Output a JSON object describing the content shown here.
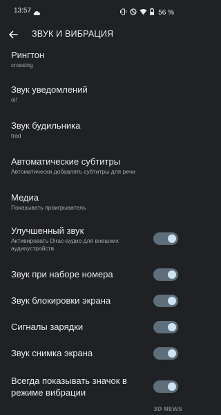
{
  "status_bar": {
    "time": "13:57",
    "battery_percent": "56 %"
  },
  "app_bar": {
    "title": "ЗВУК И ВИБРАЦИЯ"
  },
  "items": [
    {
      "title": "Рингтон",
      "subtitle": "crossing"
    },
    {
      "title": "Звук уведомлений",
      "subtitle": "oi!"
    },
    {
      "title": "Звук будильника",
      "subtitle": "trad"
    },
    {
      "title": "Автоматические субтитры",
      "subtitle": "Автоматически добавлять субтитры для речи"
    },
    {
      "title": "Медиа",
      "subtitle": "Показывать проигрыватель"
    },
    {
      "title": "Улучшенный звук",
      "subtitle": "Активировать Dirac-аудио для внешних аудиоустройств",
      "toggle": true
    },
    {
      "title": "Звук при наборе номера",
      "toggle": true
    },
    {
      "title": "Звук блокировки экрана",
      "toggle": true
    },
    {
      "title": "Сигналы зарядки",
      "toggle": true
    },
    {
      "title": "Звук снимка экрана",
      "toggle": true
    },
    {
      "title": "Всегда показывать значок в режиме вибрации",
      "toggle": true
    }
  ],
  "watermark": "3D NEWS",
  "colors": {
    "background": "#202124",
    "toggle_track": "#5e6e7a",
    "toggle_knob": "#cde3f3"
  }
}
